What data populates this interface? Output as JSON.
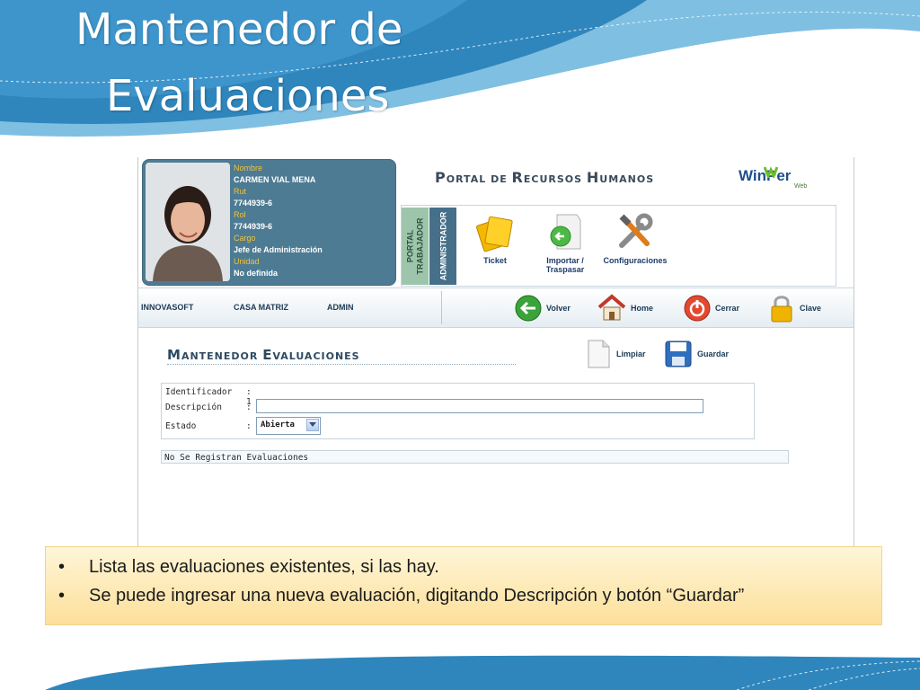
{
  "slide": {
    "title_line1": "Mantenedor de",
    "title_line2": "Evaluaciones",
    "bullet_marker": "•",
    "notes": [
      "Lista las evaluaciones existentes, si las hay.",
      "Se puede ingresar una nueva evaluación, digitando Descripción y botón “Guardar”"
    ]
  },
  "profile": {
    "name_label": "Nombre",
    "name": "CARMEN VIAL MENA",
    "rut_label": "Rut",
    "rut": "7744939-6",
    "rol_label": "Rol",
    "rol": "7744939-6",
    "cargo_label": "Cargo",
    "cargo": "Jefe de Administración",
    "unidad_label": "Unidad",
    "unidad": "No definida"
  },
  "portal": {
    "title_p": "P",
    "title_1": "ORTAL DE ",
    "title_r": "R",
    "title_2": "ECURSOS ",
    "title_h": "H",
    "title_3": "UMANOS",
    "logo_text_1": "Win",
    "logo_text_2": "Per",
    "logo_text_sub": "Web",
    "tab_trabajador": "PORTAL TRABAJADOR",
    "tab_admin": "ADMINISTRADOR",
    "menu": [
      {
        "label": "Ticket"
      },
      {
        "label": "Importar / Traspasar"
      },
      {
        "label": "Configuraciones"
      }
    ]
  },
  "nav": {
    "company": "INNOVASOFT",
    "branch": "CASA MATRIZ",
    "user": "ADMIN",
    "volver": "Volver",
    "home": "Home",
    "cerrar": "Cerrar",
    "clave": "Clave"
  },
  "form": {
    "title_m": "M",
    "title_1": "ANTENEDOR ",
    "title_e": "E",
    "title_2": "VALUACIONES",
    "limpiar": "Limpiar",
    "guardar": "Guardar",
    "id_label": "Identificador",
    "id_value": "1",
    "desc_label": "Descripción",
    "desc_value": "",
    "estado_label": "Estado",
    "estado_value": "Abierta",
    "colon": ":",
    "empty_msg": "No Se Registran Evaluaciones"
  },
  "colors": {
    "slide_blue": "#2f86bd",
    "profile_bg": "#4d7b93",
    "label_yellow": "#f5c23a",
    "notes_bg": "#fde8b0"
  },
  "icons": [
    "ticket-icon",
    "import-icon",
    "tools-icon",
    "back-arrow-icon",
    "home-icon",
    "power-icon",
    "lock-icon",
    "document-icon",
    "floppy-disk-icon",
    "chevron-down-icon"
  ]
}
